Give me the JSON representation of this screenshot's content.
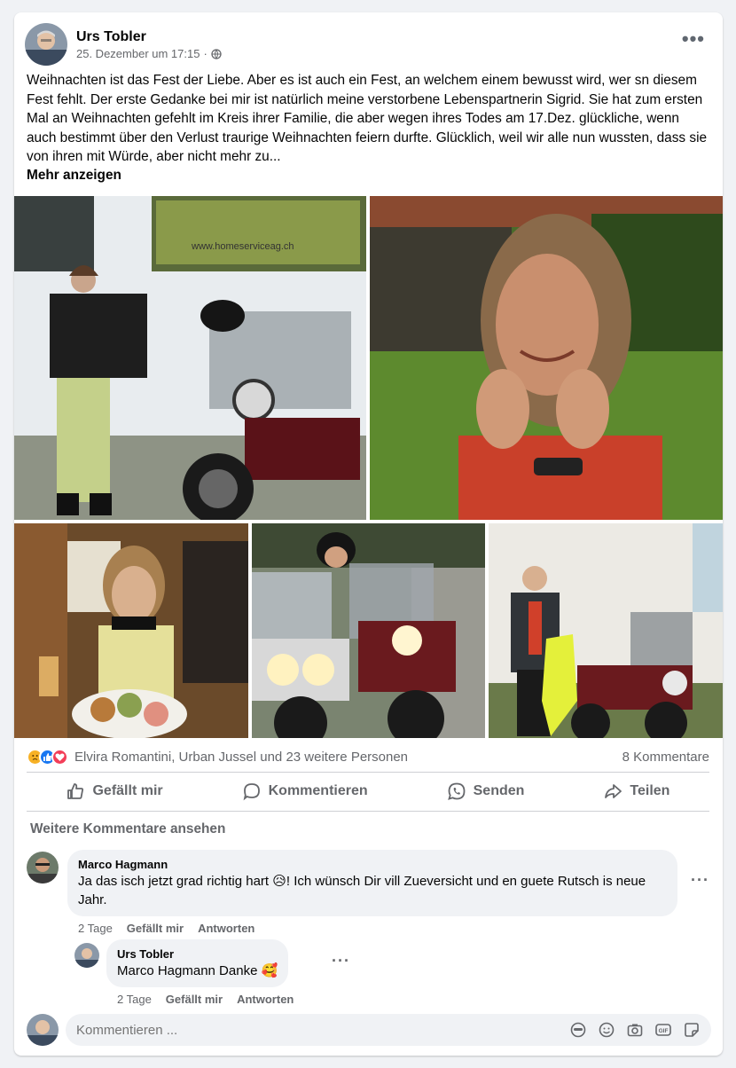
{
  "post": {
    "author": "Urs Tobler",
    "date": "25. Dezember um 17:15",
    "separator": "·",
    "text": "Weihnachten ist das Fest der Liebe. Aber es ist auch ein Fest, an welchem einem bewusst wird, wer sn diesem Fest fehlt. Der erste Gedanke bei mir ist natürlich meine verstorbene Lebenspartnerin Sigrid. Sie hat zum ersten Mal an Weihnachten gefehlt im Kreis ihrer Familie, die aber wegen ihres Todes am 17.Dez. glückliche, wenn auch bestimmt über den Verlust traurige Weihnachten feiern durfte. Glücklich, weil wir alle nun wussten, dass sie von ihren mit Würde, aber nicht mehr zu...",
    "see_more": "Mehr anzeigen",
    "photo_caption": "www.homeserviceag.ch",
    "more_icon": "more-horizontal-icon",
    "privacy_icon": "globe-icon"
  },
  "reactions": {
    "icons": [
      "sad-reaction-icon",
      "like-reaction-icon",
      "love-reaction-icon"
    ],
    "names": "Elvira Romantini, Urban Jussel und 23 weitere Personen",
    "comment_count": "8 Kommentare"
  },
  "actions": {
    "like": "Gefällt mir",
    "comment": "Kommentieren",
    "send": "Senden",
    "share": "Teilen"
  },
  "comments_section": {
    "see_more_comments": "Weitere Kommentare ansehen",
    "comments": [
      {
        "author": "Marco Hagmann",
        "text": "Ja das isch jetzt grad richtig hart 😥! Ich wünsch Dir vill Zueversicht und en guete Rutsch is neue Jahr.",
        "time": "2 Tage",
        "like": "Gefällt mir",
        "reply": "Antworten"
      },
      {
        "author": "Urs Tobler",
        "text": "Marco Hagmann Danke 🥰",
        "time": "2 Tage",
        "like": "Gefällt mir",
        "reply": "Antworten"
      }
    ]
  },
  "composer": {
    "placeholder": "Kommentieren ...",
    "icons": [
      "avatar-sticker-icon",
      "emoji-icon",
      "camera-icon",
      "gif-icon",
      "sticker-icon"
    ]
  },
  "colors": {
    "like_blue": "#1877f2",
    "love_red": "#f33e58",
    "sad_yellow": "#f7b125",
    "secondary_text": "#65676b",
    "background": "#f0f2f5"
  }
}
